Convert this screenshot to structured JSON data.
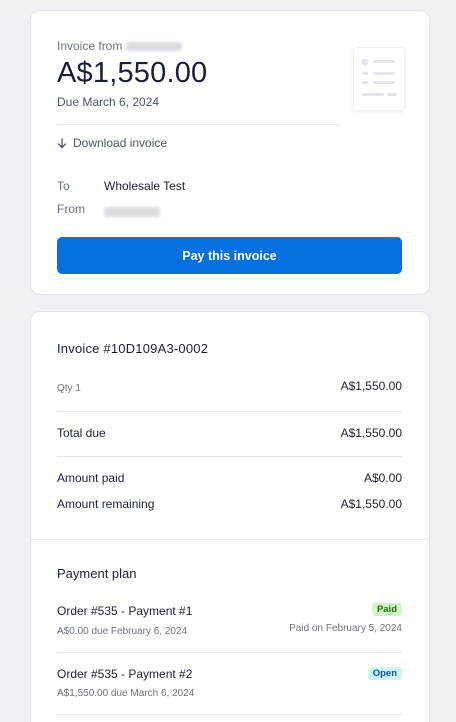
{
  "invoice_card": {
    "from_prefix": "Invoice from",
    "amount": "A$1,550.00",
    "due_date": "Due March 6, 2024",
    "download_label": "Download invoice",
    "to_label": "To",
    "to_value": "Wholesale Test",
    "from_label": "From",
    "pay_button": "Pay this invoice"
  },
  "details_card": {
    "invoice_number": "Invoice #10D109A3-0002",
    "line_item": {
      "qty": "Qty 1",
      "amount": "A$1,550.00"
    },
    "total_due": {
      "label": "Total due",
      "amount": "A$1,550.00"
    },
    "amount_paid": {
      "label": "Amount paid",
      "amount": "A$0.00"
    },
    "amount_remaining": {
      "label": "Amount remaining",
      "amount": "A$1,550.00"
    }
  },
  "payment_plan": {
    "title": "Payment plan",
    "payments": [
      {
        "title": "Order #535 - Payment #1",
        "subtitle": "A$0.00 due February 6, 2024",
        "status": "Paid",
        "status_note": "Paid on February 5, 2024"
      },
      {
        "title": "Order #535 - Payment #2",
        "subtitle": "A$1,550.00 due March 6, 2024",
        "status": "Open",
        "status_note": ""
      }
    ]
  },
  "colors": {
    "background": "#f0f1f5",
    "primary_button": "#0570de",
    "paid_badge_bg": "#d1f5c9",
    "paid_badge_text": "#217005",
    "open_badge_bg": "#cff5f6",
    "open_badge_text": "#0055bc"
  }
}
